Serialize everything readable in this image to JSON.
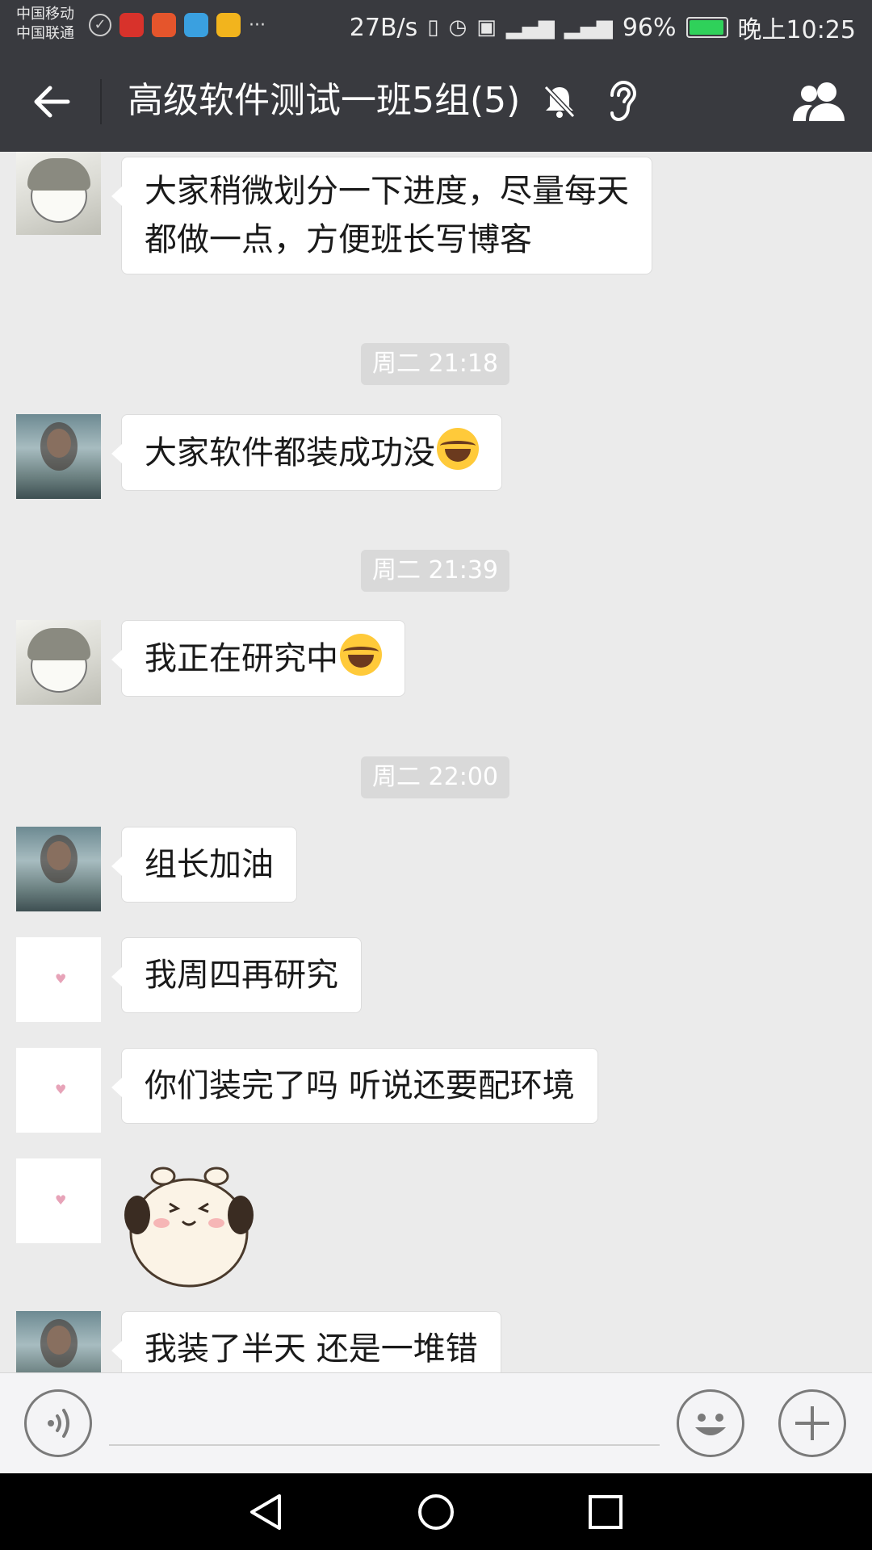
{
  "status_bar": {
    "carrier_1": "中国移动",
    "carrier_2": "中国联通",
    "speed": "27B/s",
    "battery_pct": "96%",
    "battery_level": 0.96,
    "time": "晚上10:25"
  },
  "header": {
    "title": "高级软件测试一班5组(5)",
    "icons": [
      "back-arrow-icon",
      "mute-bell-icon",
      "earpiece-icon",
      "group-members-icon"
    ]
  },
  "messages": [
    {
      "type": "text",
      "avatar": "anime",
      "text": "大家稍微划分一下进度，尽量每天",
      "text_line2": "都做一点，方便班长写博客"
    },
    {
      "type": "time",
      "text": "周二 21:18"
    },
    {
      "type": "text",
      "avatar": "photo",
      "text": "大家软件都装成功没",
      "emoji": "joy-emoji"
    },
    {
      "type": "time",
      "text": "周二 21:39"
    },
    {
      "type": "text",
      "avatar": "anime",
      "text": "我正在研究中",
      "emoji": "joy-emoji"
    },
    {
      "type": "time",
      "text": "周二 22:00"
    },
    {
      "type": "text",
      "avatar": "photo",
      "text": "组长加油"
    },
    {
      "type": "text",
      "avatar": "heart",
      "text": "我周四再研究"
    },
    {
      "type": "text",
      "avatar": "heart",
      "text": "你们装完了吗 听说还要配环境"
    },
    {
      "type": "sticker",
      "avatar": "heart",
      "sticker": "alpaca-sticker"
    },
    {
      "type": "text",
      "avatar": "photo",
      "text": "我装了半天 还是一堆错"
    }
  ],
  "input_bar": {
    "value": "",
    "icons": [
      "voice-icon",
      "emoji-icon",
      "plus-icon"
    ]
  },
  "colors": {
    "header_bg": "#393a3f",
    "chat_bg": "#ebebeb",
    "bubble_bg": "#ffffff",
    "timestamp_bg": "#d9d9d9"
  }
}
